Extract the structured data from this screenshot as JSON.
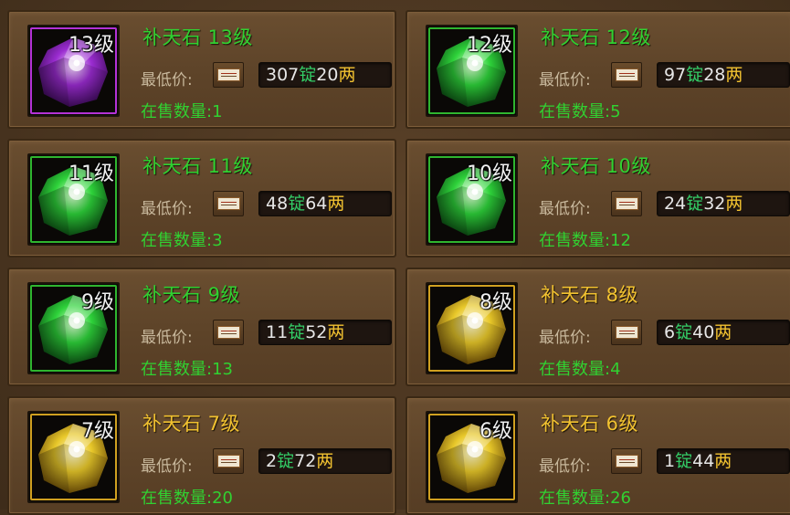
{
  "colors": {
    "name_green": "#31d131",
    "name_gold": "#f2c230",
    "ding_green": "#33cc66",
    "liang_gold": "#f2c230",
    "tier_purple": "#b432d6",
    "tier_green": "#2fb52f",
    "tier_gold": "#d0a020"
  },
  "labels": {
    "price_label": "最低价:",
    "count_prefix": "在售数量:",
    "ding_unit": "锭",
    "liang_unit": "两"
  },
  "items": [
    {
      "name": "补天石 13级",
      "level_tag": "13级",
      "tier": "purple",
      "price_ding": "307",
      "price_liang": "20",
      "count_text": "在售数量:1",
      "icon": "purple-gem-icon"
    },
    {
      "name": "补天石 12级",
      "level_tag": "12级",
      "tier": "green",
      "price_ding": "97",
      "price_liang": "28",
      "count_text": "在售数量:5",
      "icon": "green-gem-icon"
    },
    {
      "name": "补天石 11级",
      "level_tag": "11级",
      "tier": "green",
      "price_ding": "48",
      "price_liang": "64",
      "count_text": "在售数量:3",
      "icon": "green-gem-icon"
    },
    {
      "name": "补天石 10级",
      "level_tag": "10级",
      "tier": "green",
      "price_ding": "24",
      "price_liang": "32",
      "count_text": "在售数量:12",
      "icon": "green-gem-icon"
    },
    {
      "name": "补天石 9级",
      "level_tag": "9级",
      "tier": "green",
      "price_ding": "11",
      "price_liang": "52",
      "count_text": "在售数量:13",
      "icon": "green-gem-icon"
    },
    {
      "name": "补天石 8级",
      "level_tag": "8级",
      "tier": "gold",
      "price_ding": "6",
      "price_liang": "40",
      "count_text": "在售数量:4",
      "icon": "gold-gem-icon"
    },
    {
      "name": "补天石 7级",
      "level_tag": "7级",
      "tier": "gold",
      "price_ding": "2",
      "price_liang": "72",
      "count_text": "在售数量:20",
      "icon": "gold-gem-icon"
    },
    {
      "name": "补天石 6级",
      "level_tag": "6级",
      "tier": "gold",
      "price_ding": "1",
      "price_liang": "44",
      "count_text": "在售数量:26",
      "icon": "gold-gem-icon"
    }
  ]
}
